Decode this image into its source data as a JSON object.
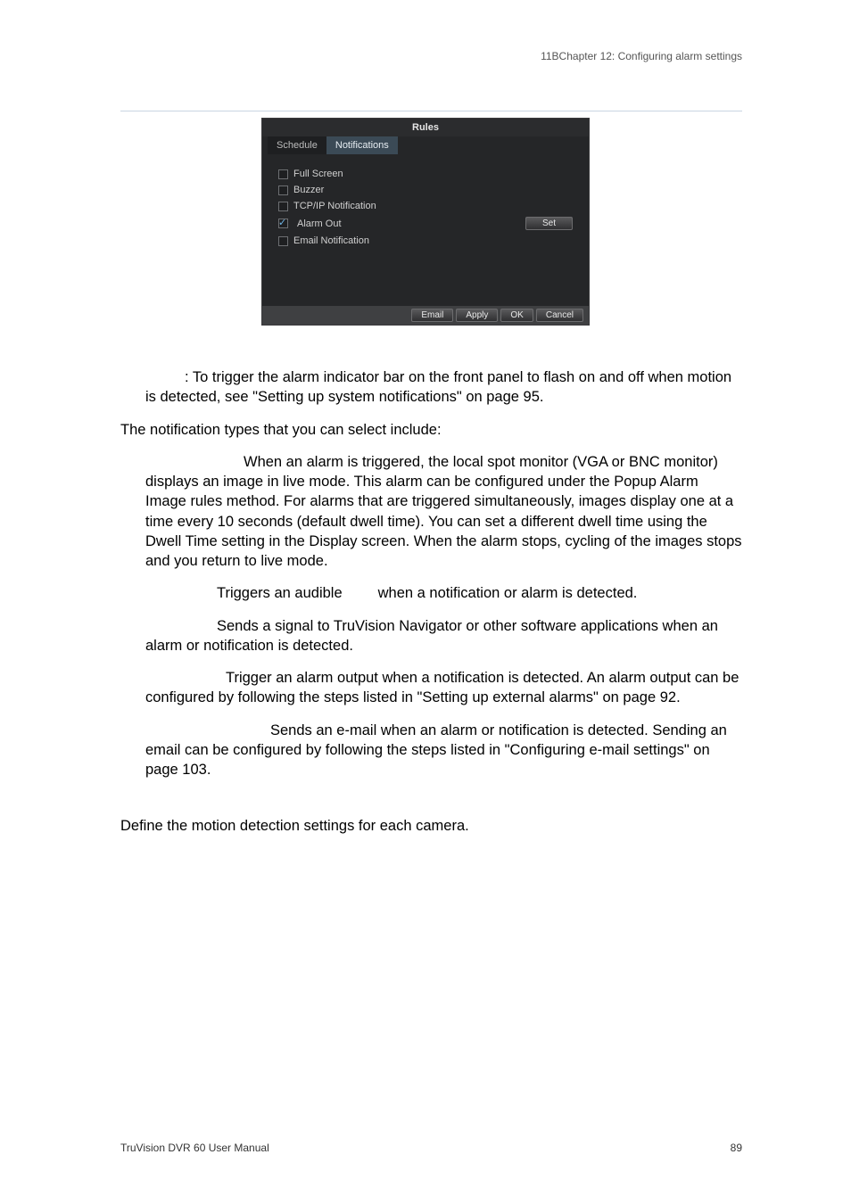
{
  "header": {
    "chapter": "11BChapter 12: Configuring alarm settings"
  },
  "dialog": {
    "title": "Rules",
    "tabs": {
      "schedule": "Schedule",
      "notifications": "Notifications"
    },
    "options": {
      "full_screen": "Full Screen",
      "buzzer": "Buzzer",
      "tcpip": "TCP/IP Notification",
      "alarm_out": "Alarm Out",
      "email": "Email Notification",
      "set": "Set"
    },
    "buttons": {
      "email": "Email",
      "apply": "Apply",
      "ok": "OK",
      "cancel": "Cancel"
    }
  },
  "body": {
    "p1_note": ": To trigger the alarm indicator bar on the front panel to flash on and off when motion is detected, see \"Setting up system notifications\" on page 95.",
    "p2": "The notification types that you can select include:",
    "p3": "When an alarm is triggered, the local spot monitor (VGA or BNC monitor) displays an image in live mode. This alarm can be configured under the Popup Alarm Image rules method. For alarms that are triggered simultaneously, images display one at a time every 10 seconds (default dwell time). You can set a different dwell time using the Dwell Time setting in the Display screen. When the alarm stops, cycling of the images stops and you return to live mode.",
    "p4a": "Triggers an audible",
    "p4b": "when a notification or alarm is detected.",
    "p5": "Sends a signal to TruVision Navigator or other software applications when an alarm or notification is detected.",
    "p6": "Trigger an alarm output when a notification is detected. An alarm output can be configured by following the steps listed in \"Setting up external alarms\" on page 92.",
    "p7": "Sends an e-mail when an alarm or notification is detected. Sending an email can be configured by following the steps listed in \"Configuring e-mail settings\" on page 103.",
    "p8": "Define the motion detection settings for each camera."
  },
  "footer": {
    "left": "TruVision DVR 60 User Manual",
    "right": "89"
  }
}
